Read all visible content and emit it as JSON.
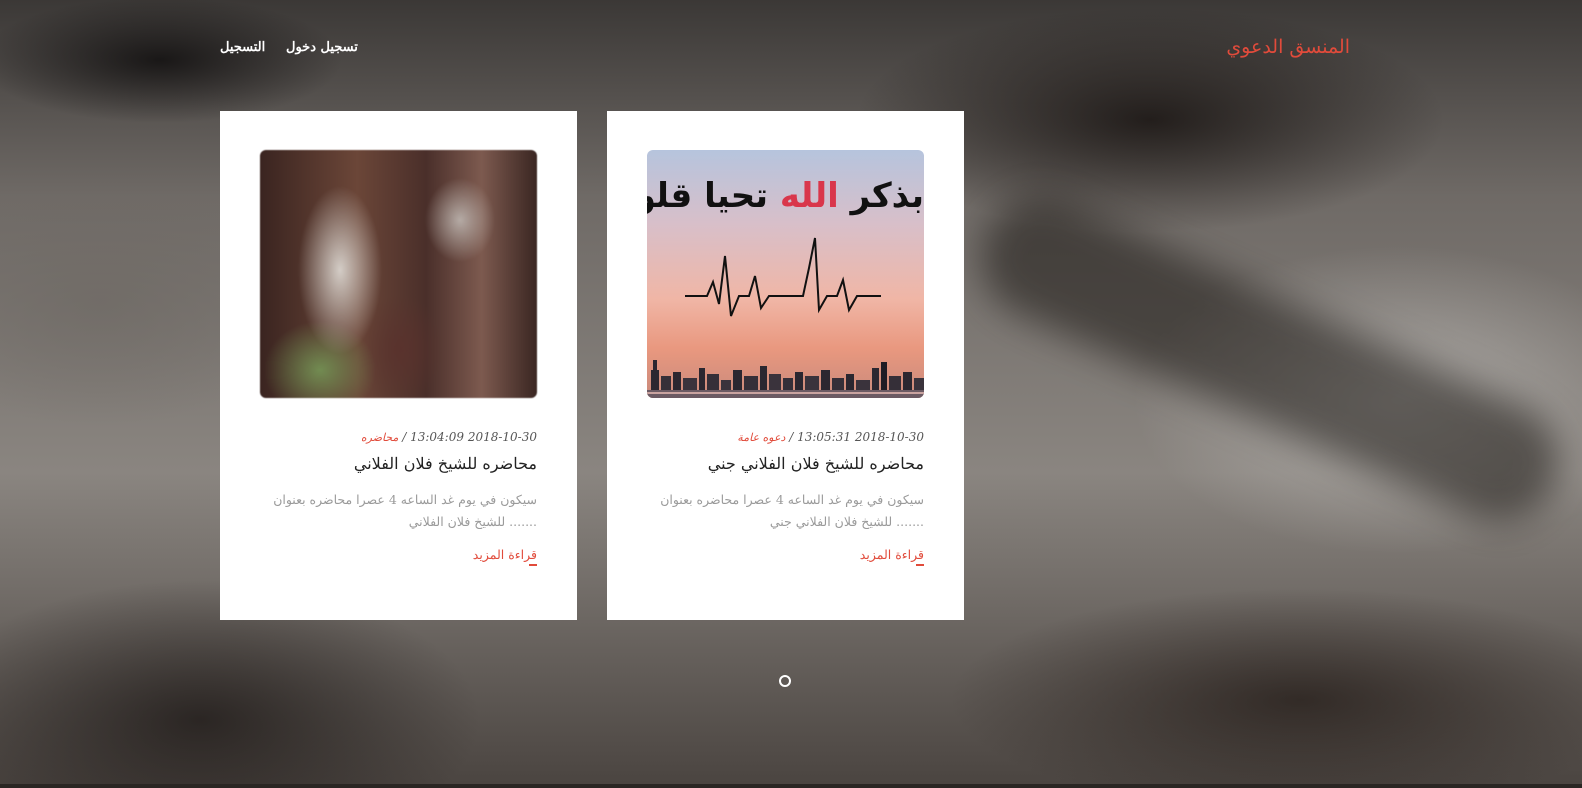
{
  "header": {
    "brand": "المنسق الدعوي",
    "login_label": "تسجيل دخول",
    "register_label": "التسجيل"
  },
  "posts": [
    {
      "image": "calligraphy-heartbeat-skyline",
      "image_text": "بذكر الله تحيا قلوبنا",
      "date": "2018-10-30 13:05:31",
      "category": "دعوه عامة",
      "title": "محاضره للشيخ فلان الفلاني جني",
      "excerpt": "سيكون في يوم غد الساعه 4 عصرا محاضره بعنوان ....... للشيخ فلان الفلاني جني",
      "more_label": "قراءة المزيد"
    },
    {
      "image": "blurred-photo",
      "date": "2018-10-30 13:04:09",
      "category": "محاضره",
      "title": "محاضره للشيخ فلان الفلاني",
      "excerpt": "سيكون في يوم غد الساعه 4 عصرا محاضره بعنوان ....... للشيخ فلان الفلاني",
      "more_label": "قراءة المزيد"
    }
  ],
  "pagination": {
    "pages": 1,
    "current": 1
  },
  "colors": {
    "accent": "#e14b3b",
    "card_bg": "#ffffff",
    "nav_text": "#ffffff"
  }
}
